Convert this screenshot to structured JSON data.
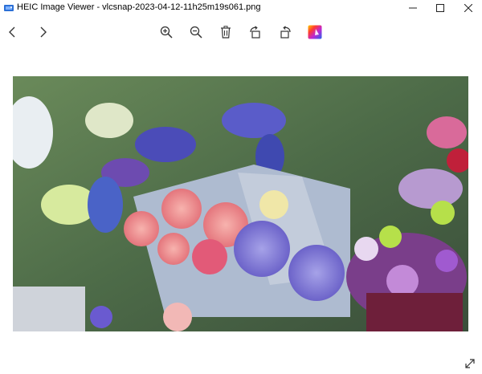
{
  "window": {
    "title": "HEIC Image Viewer - vlcsnap-2023-04-12-11h25m19s061.png",
    "app_icon": "heic-viewer-app-icon"
  },
  "window_controls": {
    "minimize_icon": "minimize-icon",
    "maximize_icon": "maximize-icon",
    "close_icon": "close-icon"
  },
  "toolbar": {
    "back_icon": "chevron-left-icon",
    "forward_icon": "chevron-right-icon",
    "zoom_in_icon": "zoom-in-icon",
    "zoom_out_icon": "zoom-out-icon",
    "delete_icon": "trash-icon",
    "rotate_left_icon": "rotate-left-icon",
    "rotate_right_icon": "rotate-right-icon",
    "color_icon": "color-palette-icon"
  },
  "viewer": {
    "image_content": "photo of flower bouquets in a flower shop",
    "fullscreen_icon": "expand-icon"
  },
  "colors": {
    "text": "#1a1a1a",
    "background": "#ffffff"
  }
}
